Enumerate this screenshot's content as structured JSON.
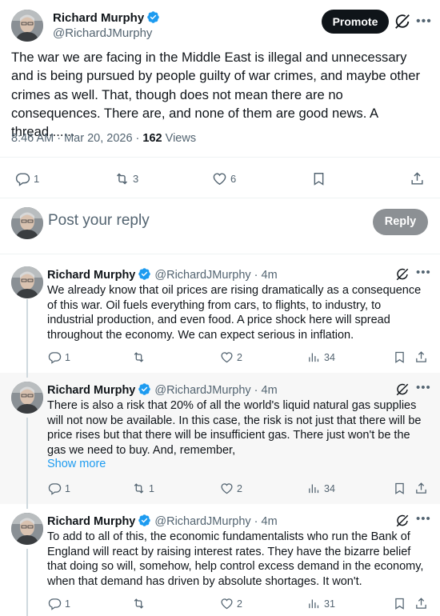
{
  "main_tweet": {
    "author_name": "Richard Murphy",
    "handle": "@RichardJMurphy",
    "promote_label": "Promote",
    "text": "The war we are facing in the Middle East is illegal and unnecessary and is being pursued by people guilty of war crimes, and maybe other crimes as well. That, though does not mean there are no consequences. There are, and none of them are good news. A thread.......",
    "time": "8:46 AM · Mar 20, 2026 · ",
    "views_count": "162",
    "views_label": " Views",
    "replies": "1",
    "reposts": "3",
    "likes": "6"
  },
  "composer": {
    "placeholder": "Post your reply",
    "reply_label": "Reply"
  },
  "replies": [
    {
      "author_name": "Richard Murphy",
      "handle_time": "@RichardJMurphy · 4m",
      "text": "We already know that oil prices are rising dramatically as a consequence of this war. Oil fuels everything from cars, to flights, to industry, to industrial production, and even food. A price shock here will spread throughout the economy. We can expect serious in inflation.",
      "replies": "1",
      "reposts": "",
      "likes": "2",
      "views": "34"
    },
    {
      "author_name": "Richard Murphy",
      "handle_time": "@RichardJMurphy · 4m",
      "text": "There is also a risk that 20% of all the world's liquid natural gas supplies will not now be available. In this case, the risk is not just that there will be price rises but that there will be insufficient gas. There just won't be the gas we need to buy. And, remember,",
      "show_more": "Show more",
      "replies": "1",
      "reposts": "1",
      "likes": "2",
      "views": "34"
    },
    {
      "author_name": "Richard Murphy",
      "handle_time": "@RichardJMurphy · 4m",
      "text": "To add to all of this, the economic fundamentalists who run the Bank of England will react by raising interest rates. They have the bizarre belief that doing so will, somehow, help control excess demand in the economy, when that demand has driven by absolute shortages. It won't.",
      "replies": "1",
      "reposts": "",
      "likes": "2",
      "views": "31"
    }
  ],
  "colors": {
    "link": "#1d9bf0",
    "verified": "#1d9bf0",
    "secondary_text": "#536471"
  }
}
